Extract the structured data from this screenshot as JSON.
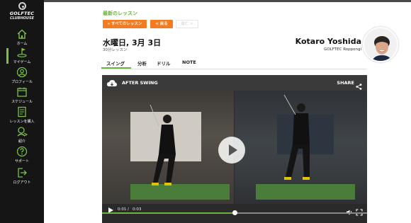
{
  "brand": {
    "title": "GOLFTEC",
    "subtitle": "CLUBHOUSE"
  },
  "sidebar": {
    "items": [
      {
        "label": "ホーム",
        "icon": "home-icon"
      },
      {
        "label": "マイゲーム",
        "icon": "golf-flag-icon",
        "active": true
      },
      {
        "label": "プロフィール",
        "icon": "user-icon"
      },
      {
        "label": "スケジュール",
        "icon": "calendar-icon"
      },
      {
        "label": "レッスンを購入",
        "icon": "receipt-icon"
      },
      {
        "label": "紹介",
        "icon": "refer-icon"
      },
      {
        "label": "サポート",
        "icon": "help-icon"
      },
      {
        "label": "ログアウト",
        "icon": "logout-icon"
      }
    ]
  },
  "header": {
    "back_link": "最新のレッスン",
    "btn_all": "« すべてのレッスン",
    "btn_prev": "< 戻る",
    "btn_next": "進む >"
  },
  "lesson": {
    "date": "水曜日, 3月 3日",
    "duration": "30分レッスン"
  },
  "coach": {
    "name": "Kotaro Yoshida",
    "location": "GOLFTEC Roppongi"
  },
  "tabs": [
    {
      "label": "スイング",
      "active": true
    },
    {
      "label": "分析"
    },
    {
      "label": "ドリル"
    },
    {
      "label": "NOTE"
    }
  ],
  "video": {
    "title": "AFTER SWING",
    "share": "SHARE",
    "current_time": "0:01",
    "separator": "/",
    "duration": "0:03",
    "progress": 0.5
  },
  "colors": {
    "accent_green": "#6cb33f",
    "accent_orange": "#f47b20",
    "sidebar_bg": "#151515"
  }
}
